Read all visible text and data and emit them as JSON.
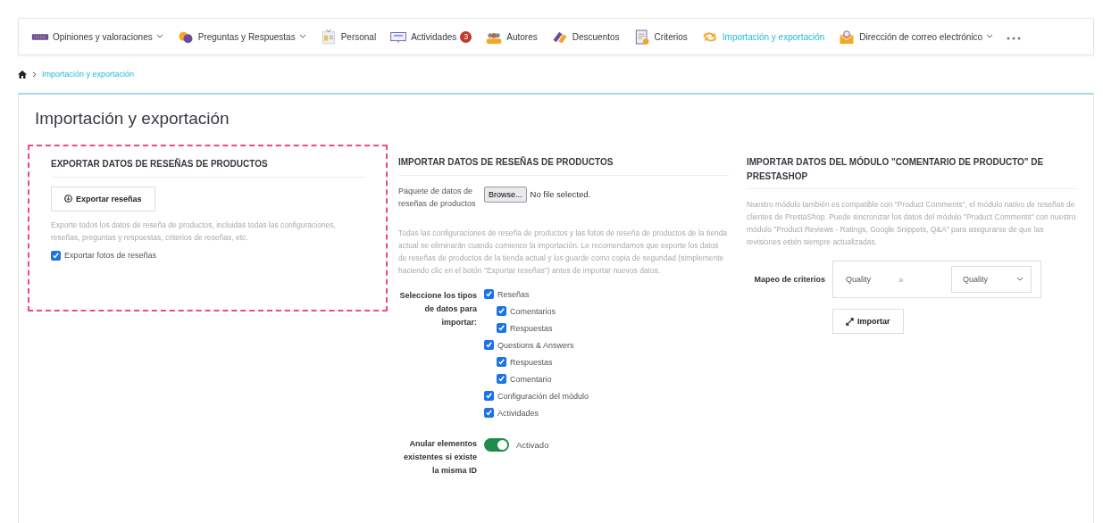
{
  "nav": [
    {
      "label": "Opiniones y valoraciones",
      "dropdown": true,
      "selected": false
    },
    {
      "label": "Preguntas y Respuestas",
      "dropdown": true,
      "selected": false
    },
    {
      "label": "Personal",
      "dropdown": false,
      "selected": false
    },
    {
      "label": "Actividades",
      "dropdown": false,
      "selected": false,
      "badge": "3"
    },
    {
      "label": "Autores",
      "dropdown": false,
      "selected": false
    },
    {
      "label": "Descuentos",
      "dropdown": false,
      "selected": false
    },
    {
      "label": "Criterios",
      "dropdown": false,
      "selected": false
    },
    {
      "label": "Importación y exportación",
      "dropdown": false,
      "selected": true
    },
    {
      "label": "Dirección de correo electrónico",
      "dropdown": true,
      "selected": false
    }
  ],
  "breadcrumb": [
    "Importación y exportación"
  ],
  "title": "Importación y exportación",
  "export": {
    "heading": "EXPORTAR DATOS DE RESEÑAS DE PRODUCTOS",
    "button": "Exportar reseñas",
    "description": "Exporte todos los datos de reseña de productos, incluidas todas las configuraciones, reseñas, preguntas y respuestas, criterios de reseñas, etc.",
    "photos": {
      "label": "Exportar fotos de reseñas",
      "checked": true
    }
  },
  "import": {
    "heading": "IMPORTAR DATOS DE RESEÑAS DE PRODUCTOS",
    "file_label": "Paquete de datos de reseñas de productos",
    "browse": "Browse...",
    "file_status": "No file selected.",
    "warning": "Todas las configuraciones de reseña de productos y las fotos de reseña de productos de la tienda actual se eliminarán cuando comience la importación. Le recomendamos que exporte los datos de reseñas de productos de la tienda actual y los guarde como copia de seguridad (simplemente haciendo clic en el botón \"Exportar reseñas\") antes de importar nuevos datos.",
    "types_label": "Seleccione los tipos de datos para importar:",
    "types": [
      {
        "label": "Reseñas",
        "checked": true,
        "children": [
          {
            "label": "Comentarios",
            "checked": true
          },
          {
            "label": "Respuestas",
            "checked": true
          }
        ]
      },
      {
        "label": "Questions & Answers",
        "checked": true,
        "children": [
          {
            "label": "Respuestas",
            "checked": true
          },
          {
            "label": "Comentario",
            "checked": true
          }
        ]
      },
      {
        "label": "Configuración del módulo",
        "checked": true
      },
      {
        "label": "Actividades",
        "checked": true
      }
    ],
    "override_label": "Anular elementos existentes si existe la misma ID",
    "override": {
      "on": true,
      "label": "Activado"
    }
  },
  "prestashop": {
    "heading": "IMPORTAR DATOS DEL MÓDULO \"COMENTARIO DE PRODUCTO\" DE PRESTASHOP",
    "description": "Nuestro módulo también es compatible con \"Product Comments\", el módulo nativo de reseñas de clientes de PrestaShop. Puede sincronizar los datos del módulo \"Product Comments\" con nuestro módulo \"Product Reviews - Ratings, Google Snippets, Q&A\" para asegurarse de que las revisiones estén siempre actualizadas.",
    "mapping_label": "Mapeo de criterios",
    "source": "Quality",
    "arrow": "»",
    "target": "Quality",
    "button": "Importar"
  }
}
